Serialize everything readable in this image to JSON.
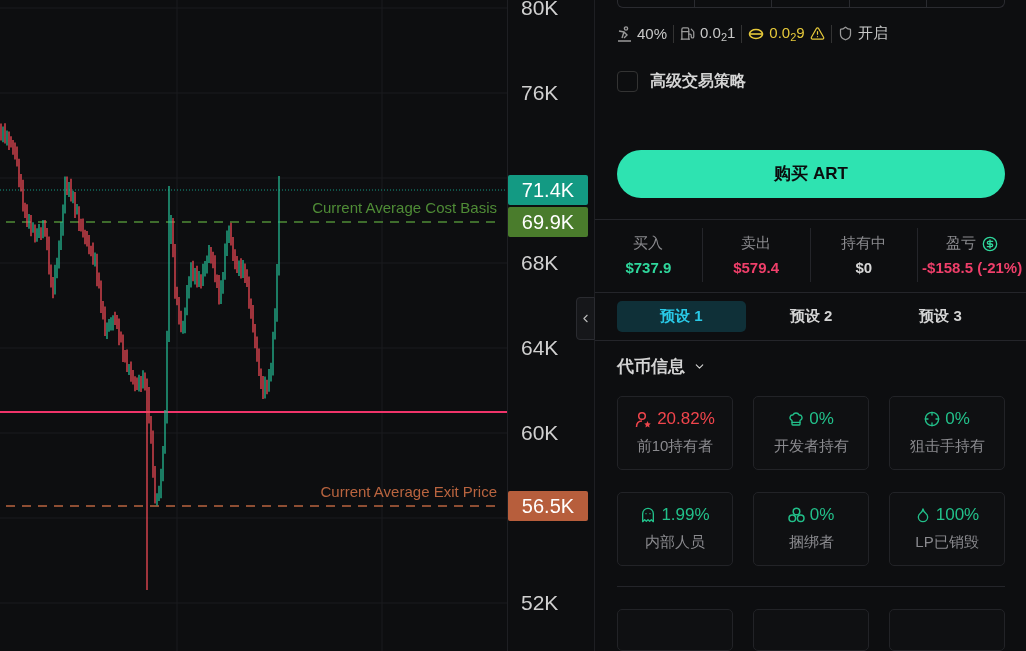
{
  "chart": {
    "price_axis": [
      "80K",
      "76K",
      "68K",
      "64K",
      "60K",
      "52K"
    ],
    "price_badges": [
      {
        "label": "71.4K",
        "color": "#139a83"
      },
      {
        "label": "69.9K",
        "color": "#4a7c2c"
      },
      {
        "label": "56.5K",
        "color": "#b75e3c"
      }
    ],
    "lines": [
      {
        "label": "Current Average Cost Basis",
        "color": "#4f8c36"
      },
      {
        "label": "Current Average Exit Price",
        "color": "#b9643f"
      }
    ]
  },
  "trade_settings": [
    {
      "value": "40%",
      "color": "#c8c8c8"
    },
    {
      "value": "0.0$_{2}$1",
      "color": "#c8c8c8"
    },
    {
      "value": "0.0$_{2}$9",
      "color": "#e6c93a",
      "warning": true
    },
    {
      "value": "开启",
      "color": "#c8c8c8"
    }
  ],
  "advanced_strategy": {
    "label": "高级交易策略",
    "checked": false
  },
  "buy_button": "购买 ART",
  "position": [
    {
      "label": "买入",
      "value": "$737.9",
      "color": "#2fd79c"
    },
    {
      "label": "卖出",
      "value": "$579.4",
      "color": "#ef3f6a"
    },
    {
      "label": "持有中",
      "value": "$0",
      "color": "#d8d8d8"
    },
    {
      "label": "盈亏",
      "value": "-$158.5 (-21%)",
      "color": "#ef3f6a",
      "kind": "pnl"
    }
  ],
  "presets": [
    {
      "label": "预设 1",
      "selected": true
    },
    {
      "label": "预设 2",
      "selected": false
    },
    {
      "label": "预设 3",
      "selected": false
    }
  ],
  "token_info": {
    "title": "代币信息",
    "stats": [
      {
        "value": "20.82%",
        "label": "前10持有者",
        "color": "#f0454c"
      },
      {
        "value": "0%",
        "label": "开发者持有",
        "color": "#22c08a"
      },
      {
        "value": "0%",
        "label": "狙击手持有",
        "color": "#22c08a"
      },
      {
        "value": "1.99%",
        "label": "内部人员",
        "color": "#22c08a"
      },
      {
        "value": "0%",
        "label": "捆绑者",
        "color": "#22c08a"
      },
      {
        "value": "100%",
        "label": "LP已销毁",
        "color": "#22c08a"
      }
    ]
  }
}
